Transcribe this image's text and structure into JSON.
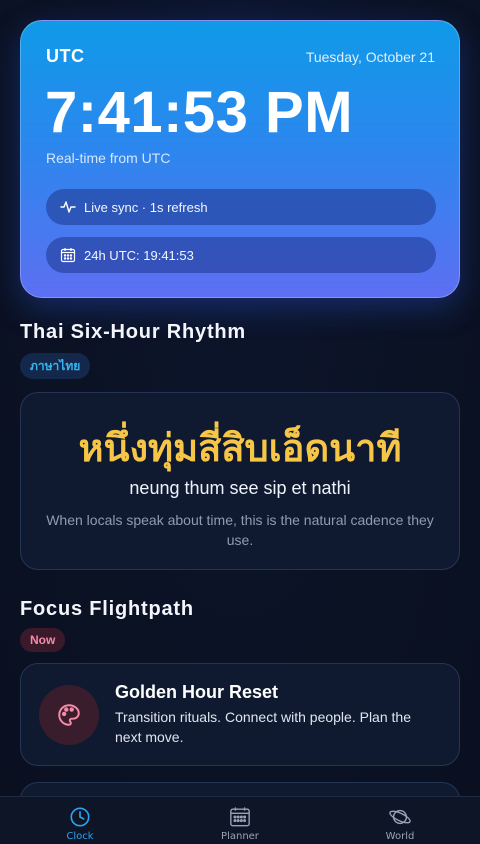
{
  "clock": {
    "timezone": "UTC",
    "date": "Tuesday, October 21",
    "time": "7:41:53 PM",
    "subtitle": "Real-time from UTC",
    "sync_label": "Live sync · 1s refresh",
    "utc24_label": "24h UTC: 19:41:53"
  },
  "thai": {
    "section_title": "Thai Six-Hour Rhythm",
    "badge": "ภาษาไทย",
    "phrase": "หนึ่งทุ่มสี่สิบเอ็ดนาที",
    "transliteration": "neung thum see sip et nathi",
    "description": "When locals speak about time, this is the natural cadence they use."
  },
  "focus": {
    "section_title": "Focus Flightpath",
    "badge": "Now",
    "task": {
      "icon": "palette-icon",
      "title": "Golden Hour Reset",
      "description": "Transition rituals. Connect with people. Plan the next move."
    }
  },
  "nav": {
    "items": [
      {
        "label": "Clock",
        "icon": "clock-icon",
        "active": true
      },
      {
        "label": "Planner",
        "icon": "calendar-icon",
        "active": false
      },
      {
        "label": "World",
        "icon": "planet-icon",
        "active": false
      }
    ]
  },
  "colors": {
    "accent": "#2aa3f0",
    "thai_gold": "#f7c646",
    "now_pink": "#f58ca7",
    "card_bg": "#0f1a30"
  }
}
